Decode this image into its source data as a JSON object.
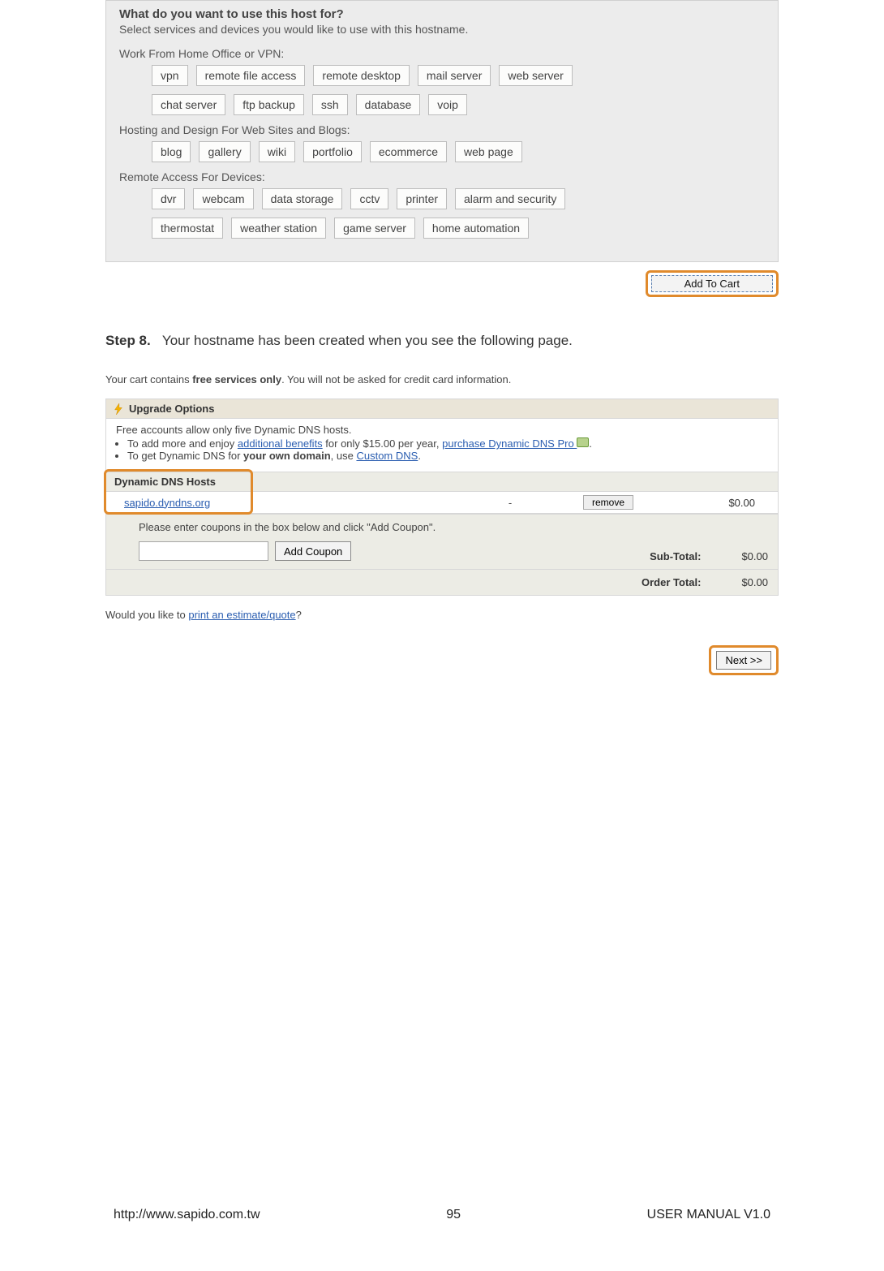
{
  "top_panel": {
    "heading": "What do you want to use this host for?",
    "sub": "Select services and devices you would like to use with this hostname.",
    "groups": [
      {
        "label": "Work From Home Office or VPN:",
        "rows": [
          [
            "vpn",
            "remote file access",
            "remote desktop",
            "mail server",
            "web server"
          ],
          [
            "chat server",
            "ftp backup",
            "ssh",
            "database",
            "voip"
          ]
        ]
      },
      {
        "label": "Hosting and Design For Web Sites and Blogs:",
        "rows": [
          [
            "blog",
            "gallery",
            "wiki",
            "portfolio",
            "ecommerce",
            "web page"
          ]
        ]
      },
      {
        "label": "Remote Access For Devices:",
        "rows": [
          [
            "dvr",
            "webcam",
            "data storage",
            "cctv",
            "printer",
            "alarm and security"
          ],
          [
            "thermostat",
            "weather station",
            "game server",
            "home automation"
          ]
        ]
      }
    ],
    "add_to_cart": "Add To Cart"
  },
  "step": {
    "label": "Step 8.",
    "text": "Your hostname has been created when you see the following page."
  },
  "cart_intro": {
    "prefix": "Your cart contains ",
    "bold": "free services only",
    "suffix": ". You will not be asked for credit card information."
  },
  "upgrade": {
    "title": "Upgrade Options",
    "line0": "Free accounts allow only five Dynamic DNS hosts.",
    "bullet1_prefix": "To add more and enjoy ",
    "bullet1_link1": "additional benefits",
    "bullet1_mid": " for only $15.00 per year, ",
    "bullet1_link2": "purchase Dynamic DNS Pro ",
    "bullet1_suffix": ".",
    "bullet2_prefix": "To get Dynamic DNS for ",
    "bullet2_bold": "your own domain",
    "bullet2_mid": ", use ",
    "bullet2_link": "Custom DNS",
    "bullet2_suffix": "."
  },
  "dns": {
    "title": "Dynamic DNS Hosts",
    "host": "sapido.dyndns.org",
    "dash": "-",
    "remove": "remove",
    "price": "$0.00"
  },
  "coupon": {
    "label": "Please enter coupons in the box below and click \"Add Coupon\".",
    "add": "Add Coupon",
    "subtotal_label": "Sub-Total:",
    "subtotal_value": "$0.00"
  },
  "order_total": {
    "label": "Order Total:",
    "value": "$0.00"
  },
  "print": {
    "prefix": "Would you like to ",
    "link": "print an estimate/quote",
    "suffix": "?"
  },
  "next_btn": "Next >>",
  "footer": {
    "left": "http://www.sapido.com.tw",
    "center": "95",
    "right": "USER MANUAL V1.0"
  }
}
